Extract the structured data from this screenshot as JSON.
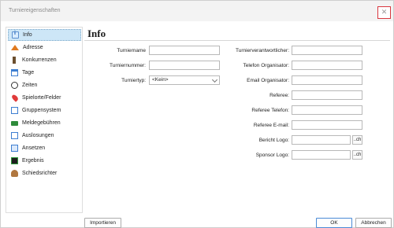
{
  "window": {
    "title": "Turniereigenschaften",
    "close_glyph": "✕"
  },
  "sidebar": {
    "items": [
      {
        "label": "Info",
        "icon": "info-icon",
        "selected": true
      },
      {
        "label": "Adresse",
        "icon": "home-icon"
      },
      {
        "label": "Konkurrenzen",
        "icon": "bracket-icon"
      },
      {
        "label": "Tage",
        "icon": "calendar-icon"
      },
      {
        "label": "Zeiten",
        "icon": "clock-icon"
      },
      {
        "label": "Spielorte/Felder",
        "icon": "location-pin-icon"
      },
      {
        "label": "Gruppensystem",
        "icon": "group-system-icon"
      },
      {
        "label": "Meldegebühren",
        "icon": "money-icon"
      },
      {
        "label": "Auslosungen",
        "icon": "draw-icon"
      },
      {
        "label": "Ansetzen",
        "icon": "schedule-icon"
      },
      {
        "label": "Ergebnis",
        "icon": "scoreboard-icon"
      },
      {
        "label": "Schiedsrichter",
        "icon": "referee-icon"
      }
    ]
  },
  "main": {
    "title": "Info",
    "left_fields": {
      "turniername": {
        "label": "Turniername",
        "value": ""
      },
      "turniernummer": {
        "label": "Turniernummer:",
        "value": ""
      },
      "turniertyp": {
        "label": "Turniertyp:",
        "value": "<Kein>"
      }
    },
    "right_fields": {
      "verantwortlicher": {
        "label": "Turnierverantwortlicher:",
        "value": ""
      },
      "telefon_org": {
        "label": "Telefon Organisator:",
        "value": ""
      },
      "email_org": {
        "label": "Email Organisator:",
        "value": ""
      },
      "referee": {
        "label": "Referee:",
        "value": ""
      },
      "referee_tel": {
        "label": "Referee Telefon:",
        "value": ""
      },
      "referee_mail": {
        "label": "Referee E-mail:",
        "value": ""
      },
      "bericht_logo": {
        "label": "Bericht Logo:",
        "value": "",
        "browse": "..ch"
      },
      "sponsor_logo": {
        "label": "Sponsor Logo:",
        "value": "",
        "browse": "..ch"
      }
    }
  },
  "footer": {
    "import_label": "Importieren",
    "ok_label": "OK",
    "cancel_label": "Abbrechen"
  },
  "colors": {
    "selected_bg": "#cde6f7",
    "close_border": "#d9363e",
    "primary_border": "#4a8bd6"
  }
}
